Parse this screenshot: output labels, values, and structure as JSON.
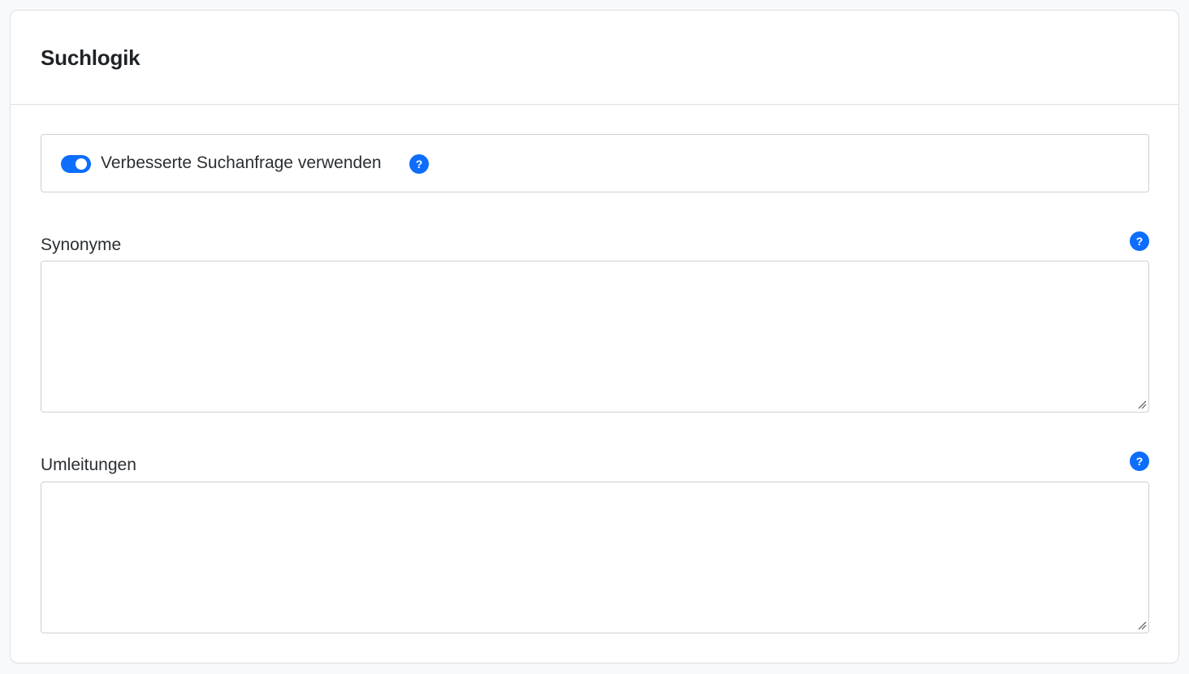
{
  "card": {
    "title": "Suchlogik"
  },
  "enhanced_query": {
    "label": "Verbesserte Suchanfrage verwenden",
    "enabled": true,
    "help_glyph": "?"
  },
  "synonyms": {
    "label": "Synonyme",
    "value": "",
    "help_glyph": "?"
  },
  "redirects": {
    "label": "Umleitungen",
    "value": "",
    "help_glyph": "?"
  },
  "colors": {
    "accent": "#0d6efd",
    "border": "#ccd0d6"
  },
  "icons": {
    "help": "help-circle-icon",
    "resize": "resize-grip-icon"
  }
}
